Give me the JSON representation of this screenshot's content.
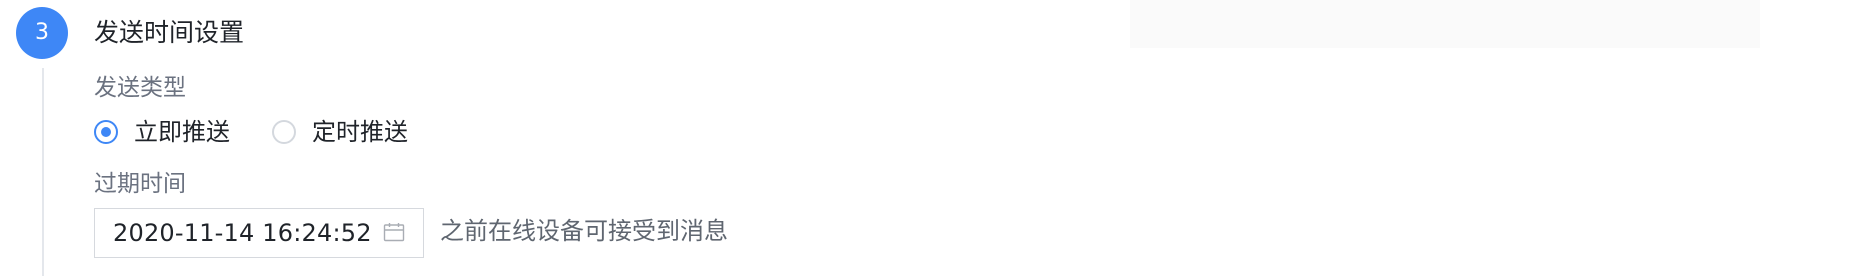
{
  "step": {
    "number": "3",
    "title": "发送时间设置"
  },
  "send_type": {
    "label": "发送类型",
    "options": [
      {
        "label": "立即推送",
        "checked": true
      },
      {
        "label": "定时推送",
        "checked": false
      }
    ]
  },
  "expire": {
    "label": "过期时间",
    "value": "2020-11-14 16:24:52",
    "suffix": "之前在线设备可接受到消息",
    "icon": "calendar-icon"
  },
  "colors": {
    "accent": "#3e87f6",
    "text": "#1f2329",
    "muted": "#6b7280",
    "border": "#d6d9de"
  }
}
